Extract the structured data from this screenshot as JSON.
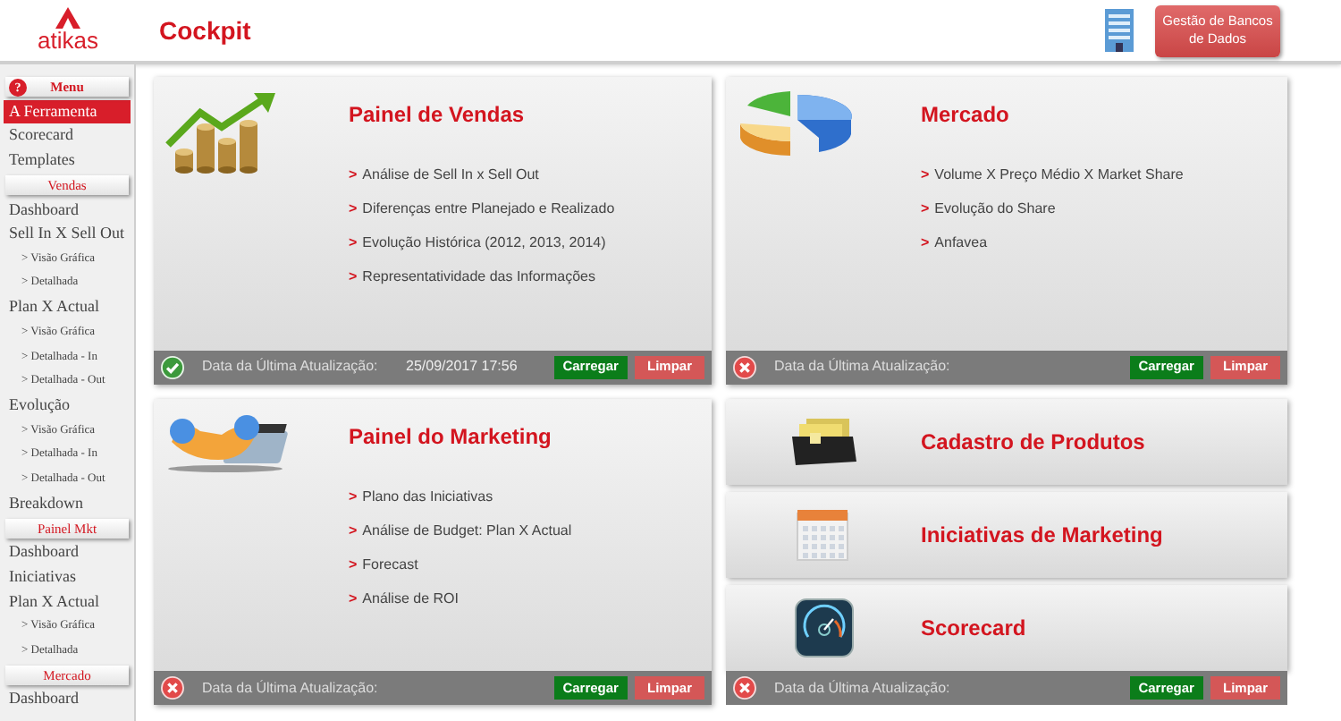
{
  "header": {
    "logo": "atikas",
    "title": "Cockpit",
    "db_button": "Gestão de Bancos de Dados"
  },
  "sidebar": [
    {
      "kind": "section",
      "label": "Menu",
      "help": "?",
      "selected": false
    },
    {
      "kind": "item",
      "label": "A Ferramenta",
      "selected": true
    },
    {
      "kind": "item",
      "label": "Scorecard",
      "selected": false
    },
    {
      "kind": "item",
      "label": "Templates",
      "selected": false
    },
    {
      "kind": "section",
      "label": "Vendas",
      "selected": false
    },
    {
      "kind": "item",
      "label": "Dashboard",
      "selected": false
    },
    {
      "kind": "item",
      "label": "Sell In X Sell Out",
      "selected": false
    },
    {
      "kind": "sub",
      "label": "> Visão Gráfica",
      "selected": false
    },
    {
      "kind": "sub",
      "label": "> Detalhada",
      "selected": false
    },
    {
      "kind": "item",
      "label": "Plan X Actual",
      "selected": false
    },
    {
      "kind": "sub",
      "label": "> Visão Gráfica",
      "selected": false
    },
    {
      "kind": "sub",
      "label": "> Detalhada  - In",
      "selected": false
    },
    {
      "kind": "sub",
      "label": "> Detalhada  - Out",
      "selected": false
    },
    {
      "kind": "item",
      "label": "Evolução",
      "selected": false
    },
    {
      "kind": "sub",
      "label": "> Visão Gráfica",
      "selected": false
    },
    {
      "kind": "sub",
      "label": "> Detalhada  - In",
      "selected": false
    },
    {
      "kind": "sub",
      "label": "> Detalhada  - Out",
      "selected": false
    },
    {
      "kind": "item",
      "label": "Breakdown",
      "selected": false
    },
    {
      "kind": "section",
      "label": "Painel Mkt",
      "selected": false
    },
    {
      "kind": "item",
      "label": "Dashboard",
      "selected": false
    },
    {
      "kind": "item",
      "label": "Iniciativas",
      "selected": false
    },
    {
      "kind": "item",
      "label": "Plan X Actual",
      "selected": false
    },
    {
      "kind": "sub",
      "label": "> Visão Gráfica",
      "selected": false
    },
    {
      "kind": "sub",
      "label": "> Detalhada",
      "selected": false
    },
    {
      "kind": "section",
      "label": "Mercado",
      "selected": false
    },
    {
      "kind": "item",
      "label": "Dashboard",
      "selected": false
    }
  ],
  "panels": {
    "sales": {
      "title": "Painel de Vendas",
      "bullet_mark": ">",
      "bullets": [
        "Análise de Sell In x Sell Out",
        "Diferenças entre Planejado e Realizado",
        "Evolução Histórica (2012, 2013, 2014)",
        "Representatividade das Informações"
      ],
      "footer": {
        "ok": true,
        "label": "Data da Última Atualização:",
        "date": "25/09/2017 17:56",
        "load": "Carregar",
        "clear": "Limpar"
      }
    },
    "market": {
      "title": "Mercado",
      "bullet_mark": ">",
      "bullets": [
        "Volume X Preço Médio X Market Share",
        "Evolução do Share",
        "Anfavea"
      ],
      "footer": {
        "ok": false,
        "label": "Data da Última Atualização:",
        "load": "Carregar",
        "clear": "Limpar"
      }
    },
    "marketing": {
      "title": "Painel do Marketing",
      "bullet_mark": ">",
      "bullets": [
        "Plano das Iniciativas",
        "Análise de Budget: Plan X Actual",
        "Forecast",
        "Análise de ROI"
      ],
      "footer": {
        "ok": false,
        "label": "Data da Última Atualização:",
        "load": "Carregar",
        "clear": "Limpar"
      }
    },
    "shortcuts": {
      "tiles": [
        "Cadastro de Produtos",
        "Iniciativas de Marketing",
        "Scorecard"
      ],
      "footer": {
        "ok": false,
        "label": "Data da Última Atualização:",
        "load": "Carregar",
        "clear": "Limpar"
      }
    }
  }
}
